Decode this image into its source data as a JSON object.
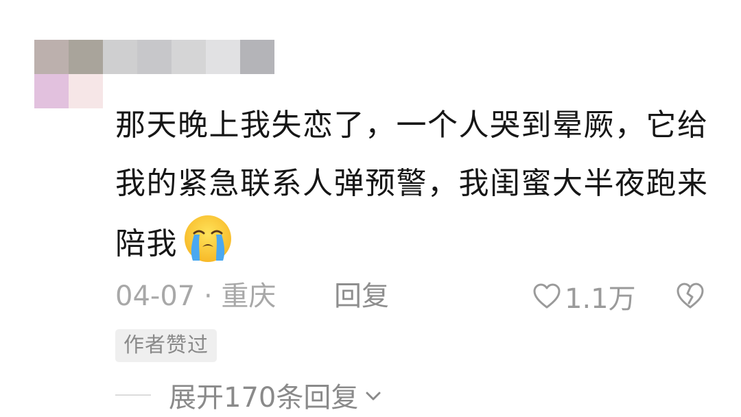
{
  "comment": {
    "text": "那天晚上我失恋了，一个人哭到晕厥，它给我的紧急联系人弹预警，我闺蜜大半夜跑来陪我",
    "emoji": "loudly-crying-face-icon"
  },
  "meta": {
    "date_location": "04-07 · 重庆",
    "reply_label": "回复",
    "like_count": "1.1万"
  },
  "badge": {
    "author_liked": "作者赞过"
  },
  "expand": {
    "label": "展开170条回复"
  },
  "colors": {
    "text": "#161616",
    "meta": "#a8a8a8",
    "badge_bg": "#efefef"
  }
}
